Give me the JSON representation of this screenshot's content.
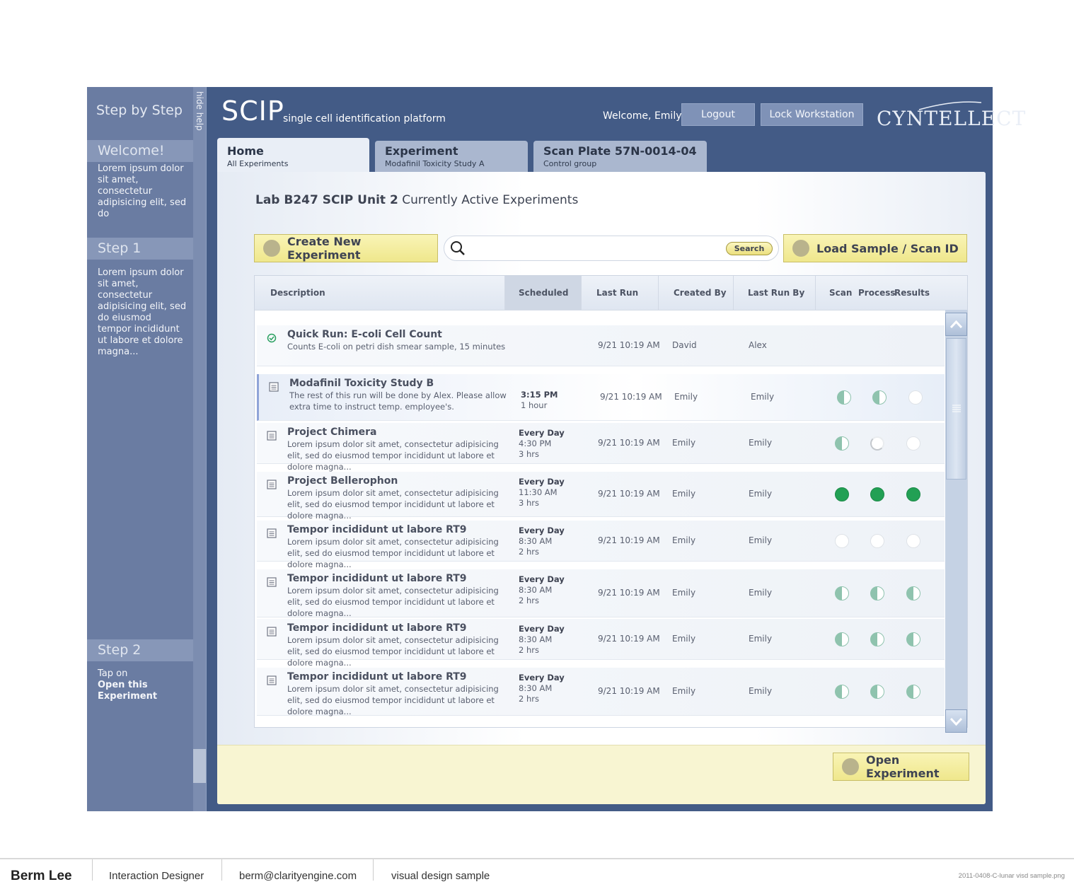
{
  "sidebar": {
    "title": "Step by Step",
    "hide_help": "hide help",
    "steps": [
      {
        "head": "Welcome!",
        "text": "Lorem ipsum dolor sit amet, consectetur adipisicing elit, sed do"
      },
      {
        "head": "Step 1",
        "text": "Lorem ipsum dolor sit amet, consectetur adipisicing elit, sed do eiusmod tempor incididunt ut labore et dolore magna..."
      },
      {
        "head": "Step 2",
        "text_pre": "Tap on",
        "text_bold": "Open this Experiment"
      }
    ]
  },
  "header": {
    "logo": "SCIP",
    "subtitle": "single cell identification platform",
    "welcome": "Welcome, Emily",
    "logout": "Logout",
    "lock": "Lock Workstation",
    "brand": "CYNTELLECT"
  },
  "tabs": [
    {
      "title": "Home",
      "sub": "All Experiments"
    },
    {
      "title": "Experiment",
      "sub": "Modafinil Toxicity Study A"
    },
    {
      "title": "Scan Plate 57N-0014-04",
      "sub": "Control group"
    }
  ],
  "main": {
    "title_bold": "Lab B247 SCIP Unit 2",
    "title_rest": "Currently Active Experiments",
    "create_button": "Create New Experiment",
    "search_button": "Search",
    "search_placeholder": "",
    "load_button": "Load Sample / Scan ID",
    "open_button": "Open Experiment"
  },
  "table": {
    "columns": [
      "Description",
      "Scheduled",
      "Last Run",
      "Created By",
      "Last Run By",
      "Scan",
      "Process",
      "Results"
    ],
    "rows": [
      {
        "title": "Quick Run: E-coli Cell Count",
        "desc": "Counts E-coli on petri dish smear sample, 15 minutes",
        "sched_bold": "",
        "sched": "",
        "last_run": "9/21 10:19 AM",
        "created_by": "David",
        "last_run_by": "Alex",
        "status": [
          "none",
          "none",
          "none"
        ],
        "icon": "check-icon"
      },
      {
        "title": "Modafinil Toxicity Study B",
        "desc": "The rest of this run will be done by Alex. Please allow extra time to instruct temp. employee's.",
        "sched_bold": "3:15 PM",
        "sched": "1 hour",
        "last_run": "9/21 10:19 AM",
        "created_by": "Emily",
        "last_run_by": "Emily",
        "status": [
          "half",
          "half",
          "empty"
        ],
        "icon": "document-icon"
      },
      {
        "title": "Project Chimera",
        "desc": "Lorem ipsum dolor sit amet, consectetur adipisicing elit, sed do eiusmod tempor incididunt ut labore et dolore magna...",
        "sched_bold": "Every Day",
        "sched": "4:30 PM\n3 hrs",
        "last_run": "9/21 10:19 AM",
        "created_by": "Emily",
        "last_run_by": "Emily",
        "status": [
          "half",
          "partial",
          "empty"
        ],
        "icon": "document-icon"
      },
      {
        "title": "Project Bellerophon",
        "desc": "Lorem ipsum dolor sit amet, consectetur adipisicing elit, sed do eiusmod tempor incididunt ut labore et dolore magna...",
        "sched_bold": "Every Day",
        "sched": "11:30 AM\n3 hrs",
        "last_run": "9/21 10:19 AM",
        "created_by": "Emily",
        "last_run_by": "Emily",
        "status": [
          "full",
          "full",
          "full"
        ],
        "icon": "document-icon"
      },
      {
        "title": "Tempor incididunt ut labore RT9",
        "desc": "Lorem ipsum dolor sit amet, consectetur adipisicing elit, sed do eiusmod tempor incididunt ut labore et dolore magna...",
        "sched_bold": "Every Day",
        "sched": "8:30 AM\n2 hrs",
        "last_run": "9/21 10:19 AM",
        "created_by": "Emily",
        "last_run_by": "Emily",
        "status": [
          "empty",
          "empty",
          "empty"
        ],
        "icon": "document-icon"
      },
      {
        "title": "Tempor incididunt ut labore RT9",
        "desc": "Lorem ipsum dolor sit amet, consectetur adipisicing elit, sed do eiusmod tempor incididunt ut labore et dolore magna...",
        "sched_bold": "Every Day",
        "sched": "8:30 AM\n2 hrs",
        "last_run": "9/21 10:19 AM",
        "created_by": "Emily",
        "last_run_by": "Emily",
        "status": [
          "half",
          "half",
          "half"
        ],
        "icon": "document-icon"
      },
      {
        "title": "Tempor incididunt ut labore RT9",
        "desc": "Lorem ipsum dolor sit amet, consectetur adipisicing elit, sed do eiusmod tempor incididunt ut labore et dolore magna...",
        "sched_bold": "Every Day",
        "sched": "8:30 AM\n2 hrs",
        "last_run": "9/21 10:19 AM",
        "created_by": "Emily",
        "last_run_by": "Emily",
        "status": [
          "half",
          "half",
          "half"
        ],
        "icon": "document-icon"
      },
      {
        "title": "Tempor incididunt ut labore RT9",
        "desc": "Lorem ipsum dolor sit amet, consectetur adipisicing elit, sed do eiusmod tempor incididunt ut labore et dolore magna...",
        "sched_bold": "Every Day",
        "sched": "8:30 AM\n2 hrs",
        "last_run": "9/21 10:19 AM",
        "created_by": "Emily",
        "last_run_by": "Emily",
        "status": [
          "half",
          "half",
          "half"
        ],
        "icon": "document-icon"
      }
    ]
  },
  "footer": {
    "name": "Berm Lee",
    "role": "Interaction Designer",
    "email": "berm@clarityengine.com",
    "note": "visual design sample",
    "file": "2011-0408-C-lunar visd sample.png"
  },
  "colors": {
    "frame": "#435b86",
    "sidebar": "#6a7ca2",
    "accent_yellow": "#efe78c",
    "status_green": "#22a054",
    "status_half": "#8fc3ae"
  }
}
